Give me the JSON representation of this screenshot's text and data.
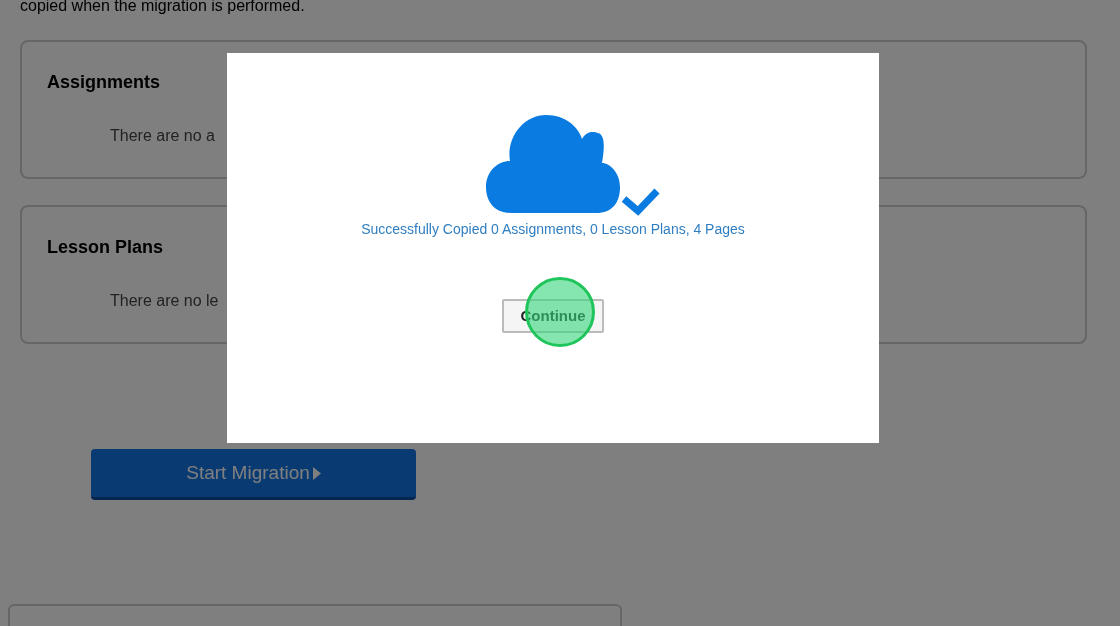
{
  "page": {
    "intro_text": "copied when the migration is performed.",
    "sections": [
      {
        "title": "Assignments",
        "message": "There are no a"
      },
      {
        "title": "Lesson Plans",
        "message": "There are no le"
      }
    ],
    "start_button": {
      "label": "Start Migration"
    }
  },
  "dialog": {
    "message": "Successfully Copied 0 Assignments, 0 Lesson Plans, 4 Pages",
    "button": {
      "label": "Continue"
    }
  }
}
